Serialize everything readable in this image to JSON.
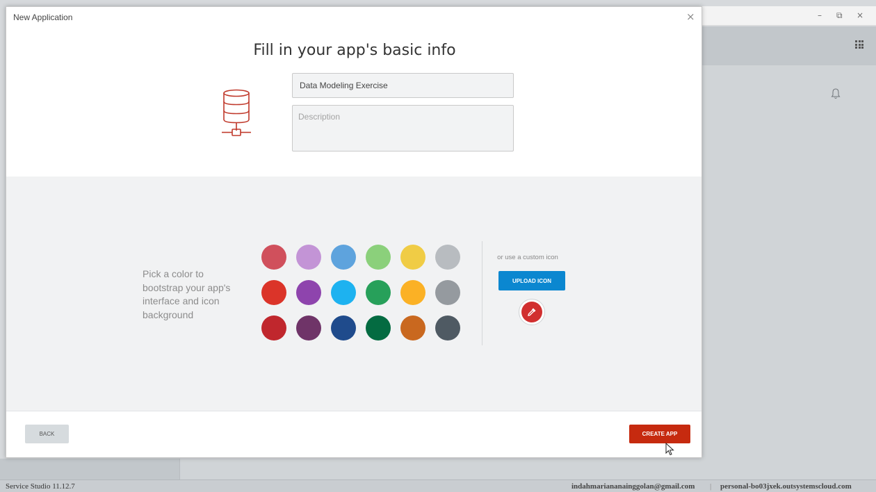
{
  "dialog": {
    "title": "New Application",
    "close_glyph": "×",
    "heading": "Fill in your app's basic info",
    "app_name_value": "Data Modeling Exercise",
    "description_placeholder": "Description",
    "app_icon": "database-server-icon"
  },
  "color_picker": {
    "prompt": "Pick a color to bootstrap your app's interface and icon background",
    "colors": [
      [
        "#d0505c",
        "#c394d6",
        "#5ea3dd",
        "#8bd07b",
        "#f0cc45",
        "#b8bcc0"
      ],
      [
        "#db3429",
        "#8e44ad",
        "#1db2f0",
        "#27a05a",
        "#fbb125",
        "#959a9f"
      ],
      [
        "#c0272d",
        "#6f3468",
        "#1f4b8c",
        "#046b41",
        "#c9681f",
        "#4f5a63"
      ]
    ],
    "custom_icon_text": "or use a custom icon",
    "upload_label": "UPLOAD ICON",
    "eyedropper_icon": "eyedropper-icon",
    "accent_color": "#0b87d0"
  },
  "footer": {
    "back_label": "BACK",
    "create_label": "CREATE APP",
    "create_color": "#c62a0f"
  },
  "window_controls": {
    "minimize": "–",
    "restore": "⧉",
    "close": "×"
  },
  "status_bar": {
    "version": "Service Studio 11.12.7",
    "email": "indahmariananainggolan@gmail.com",
    "separator": "|",
    "server": "personal-bo03jxek.outsystemscloud.com"
  }
}
